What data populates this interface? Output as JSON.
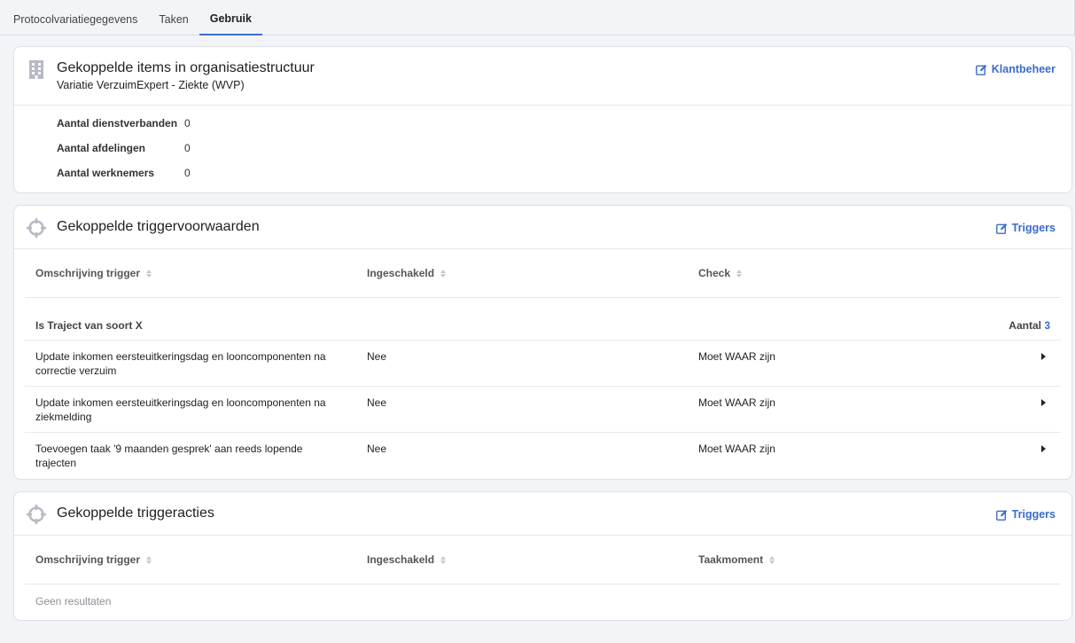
{
  "tabs": [
    {
      "label": "Protocolvariatiegegevens",
      "active": false
    },
    {
      "label": "Taken",
      "active": false
    },
    {
      "label": "Gebruik",
      "active": true
    }
  ],
  "org": {
    "title": "Gekoppelde items in organisatiestructuur",
    "subtitle": "Variatie VerzuimExpert - Ziekte (WVP)",
    "link": "Klantbeheer",
    "icon": "building-icon",
    "rows": [
      {
        "label": "Aantal dienstverbanden",
        "value": "0"
      },
      {
        "label": "Aantal afdelingen",
        "value": "0"
      },
      {
        "label": "Aantal werknemers",
        "value": "0"
      }
    ]
  },
  "conditions": {
    "title": "Gekoppelde triggervoorwaarden",
    "link": "Triggers",
    "icon": "crosshair-icon",
    "columns": [
      "Omschrijving trigger",
      "Ingeschakeld",
      "Check"
    ],
    "group": {
      "label": "Is Traject van soort X",
      "count_label": "Aantal",
      "count": "3"
    },
    "rows": [
      {
        "description": "Update inkomen eersteuitkeringsdag en looncomponenten na correctie verzuim",
        "enabled": "Nee",
        "check": "Moet WAAR zijn"
      },
      {
        "description": "Update inkomen eersteuitkeringsdag en looncomponenten na ziekmelding",
        "enabled": "Nee",
        "check": "Moet WAAR zijn"
      },
      {
        "description": "Toevoegen taak '9 maanden gesprek' aan reeds lopende trajecten",
        "enabled": "Nee",
        "check": "Moet WAAR zijn"
      }
    ]
  },
  "actions": {
    "title": "Gekoppelde triggeracties",
    "link": "Triggers",
    "icon": "crosshair-icon",
    "columns": [
      "Omschrijving trigger",
      "Ingeschakeld",
      "Taakmoment"
    ],
    "empty": "Geen resultaten"
  },
  "colors": {
    "accent": "#3a6cc9",
    "icon": "#b7bac3"
  }
}
